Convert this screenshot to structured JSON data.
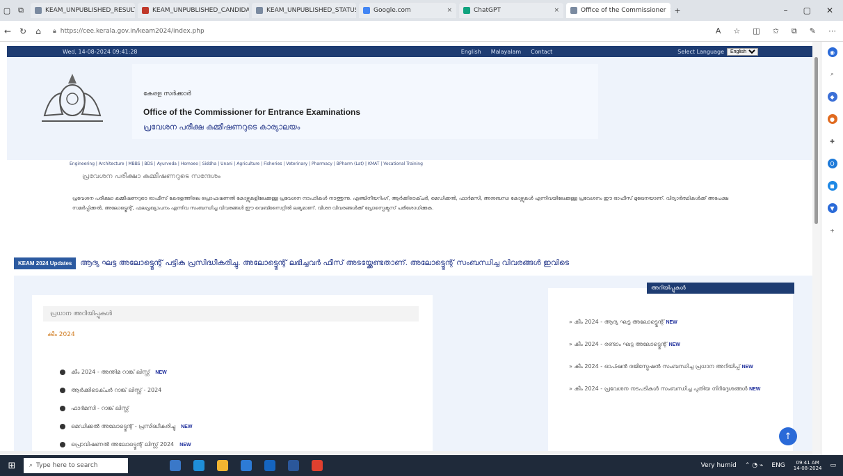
{
  "browser": {
    "tabs": [
      {
        "label": "KEAM_UNPUBLISHED_RESULT"
      },
      {
        "label": "KEAM_UNPUBLISHED_CANDIDATE"
      },
      {
        "label": "KEAM_UNPUBLISHED_STATUS"
      },
      {
        "label": "Google.com"
      },
      {
        "label": "ChatGPT"
      },
      {
        "label": "Office of the Commissioner",
        "active": true
      }
    ],
    "url": "https://cee.kerala.gov.in/keam2024/index.php"
  },
  "site": {
    "date_time": "Wed, 14-08-2024 09:41:28",
    "top_links": [
      "English",
      "Malayalam",
      "Contact"
    ],
    "language_label": "Select Language",
    "language_value": "English",
    "header_ml1": "കേരള സർക്കാർ",
    "header_title": "Office of the Commissioner for Entrance Examinations",
    "header_ml2": "പ്രവേശന പരീക്ഷ കമ്മീഷണറുടെ കാര്യാലയം",
    "menu_text": "Engineering | Architecture | MBBS | BDS | Ayurveda | Homoeo | Siddha | Unani | Agriculture | Fisheries | Veterinary | Pharmacy | BPharm (Lat) | KMAT | Vocational Training",
    "section_title": "പ്രവേശന പരീക്ഷാ കമ്മീഷണറുടെ സന്ദേശം",
    "intro_text": "പ്രവേശന പരീക്ഷാ കമ്മീഷണറുടെ ഓഫീസ് കേരളത്തിലെ പ്രൊഫഷണൽ കോഴ്സുകളിലേക്കുള്ള പ്രവേശന നടപടികൾ നടത്തുന്നു. എഞ്ചിനീയറിംഗ്, ആർക്കിടെക്ചർ, മെഡിക്കൽ, ഫാർമസി, അനുബന്ധ കോഴ്സുകൾ എന്നിവയിലേക്കുള്ള പ്രവേശനം ഈ ഓഫീസ് മുഖേനയാണ്. വിദ്യാർത്ഥികൾക്ക് അപേക്ഷ സമർപ്പിക്കൽ, അലോട്ട്മെന്റ്, ഫലപ്രഖ്യാപനം എന്നിവ സംബന്ധിച്ച വിവരങ്ങൾ ഈ വെബ്സൈറ്റിൽ ലഭ്യമാണ്. വിശദ വിവരങ്ങൾക്ക് പ്രോസ്പെക്ടസ് പരിശോധിക്കുക.",
    "ticker_badge": "KEAM 2024 Updates",
    "ticker_text": "ആദ്യ ഘട്ട അലോട്ട്മെന്റ് പട്ടിക പ്രസിദ്ധീകരിച്ചു. അലോട്ട്മെന്റ് ലഭിച്ചവർ ഫീസ് അടയ്ക്കേണ്ടതാണ്. അലോട്ട്മെന്റ് സംബന്ധിച്ച വിവരങ്ങൾ ഇവിടെ",
    "panel_header": "പ്രധാന അറിയിപ്പുകൾ",
    "panel_sub": "കീം 2024",
    "notices": [
      {
        "text": "കീം 2024 - അന്തിമ റാങ്ക് ലിസ്റ്റ്",
        "new": "NEW"
      },
      {
        "text": "ആർക്കിടെക്ചർ റാങ്ക് ലിസ്റ്റ് - 2024",
        "new": ""
      },
      {
        "text": "ഫാർമസി - റാങ്ക് ലിസ്റ്റ്",
        "new": ""
      },
      {
        "text": "മെഡിക്കൽ അലോട്ട്മെന്റ് - പ്രസിദ്ധീകരിച്ചു",
        "new": "NEW"
      },
      {
        "text": "പ്രൊവിഷണൽ അലോട്ട്മെന്റ് ലിസ്റ്റ് 2024",
        "new": "NEW"
      }
    ],
    "right_header": "അറിയിപ്പുകൾ",
    "right_notices": [
      {
        "text": "കീം 2024 - ആദ്യ ഘട്ട അലോട്ട്മെന്റ്",
        "new": "NEW"
      },
      {
        "text": "കീം 2024 - രണ്ടാം ഘട്ട അലോട്ട്മെന്റ്",
        "new": "NEW"
      },
      {
        "text": "കീം 2024 - ഓപ്ഷൻ രജിസ്ട്രേഷൻ സംബന്ധിച്ച പ്രധാന അറിയിപ്പ്",
        "new": "NEW"
      },
      {
        "text": "കീം 2024 - പ്രവേശന നടപടികൾ സംബന്ധിച്ച പുതിയ നിർദ്ദേശങ്ങൾ",
        "new": "NEW"
      }
    ]
  },
  "taskbar": {
    "search_placeholder": "Type here to search",
    "weather": "Very humid",
    "lang": "ENG",
    "time": "09:41 AM",
    "date": "14-08-2024"
  }
}
